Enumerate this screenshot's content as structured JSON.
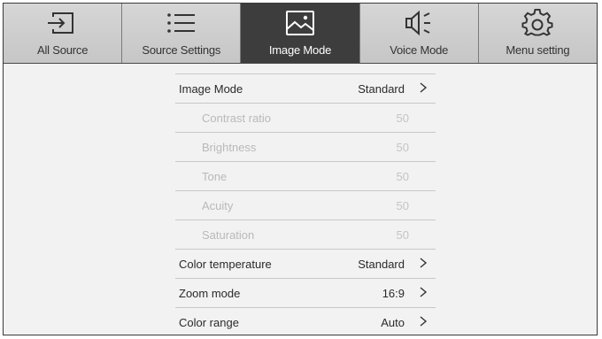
{
  "tabs": [
    {
      "label": "All Source",
      "icon": "input-source-icon",
      "active": false
    },
    {
      "label": "Source Settings",
      "icon": "list-icon",
      "active": false
    },
    {
      "label": "Image Mode",
      "icon": "image-icon",
      "active": true
    },
    {
      "label": "Voice Mode",
      "icon": "speaker-icon",
      "active": false
    },
    {
      "label": "Menu setting",
      "icon": "gear-icon",
      "active": false
    }
  ],
  "settings": {
    "image_mode": {
      "label": "Image Mode",
      "value": "Standard"
    },
    "contrast_ratio": {
      "label": "Contrast ratio",
      "value": "50"
    },
    "brightness": {
      "label": "Brightness",
      "value": "50"
    },
    "tone": {
      "label": "Tone",
      "value": "50"
    },
    "acuity": {
      "label": "Acuity",
      "value": "50"
    },
    "saturation": {
      "label": "Saturation",
      "value": "50"
    },
    "color_temperature": {
      "label": "Color temperature",
      "value": "Standard"
    },
    "zoom_mode": {
      "label": "Zoom mode",
      "value": "16:9"
    },
    "color_range": {
      "label": "Color range",
      "value": "Auto"
    }
  },
  "colors": {
    "active_tab": "#3d3d3d",
    "tab_bg": "#cfcfcf",
    "panel_bg": "#f2f2f2",
    "disabled_text": "#b9b9b9"
  }
}
